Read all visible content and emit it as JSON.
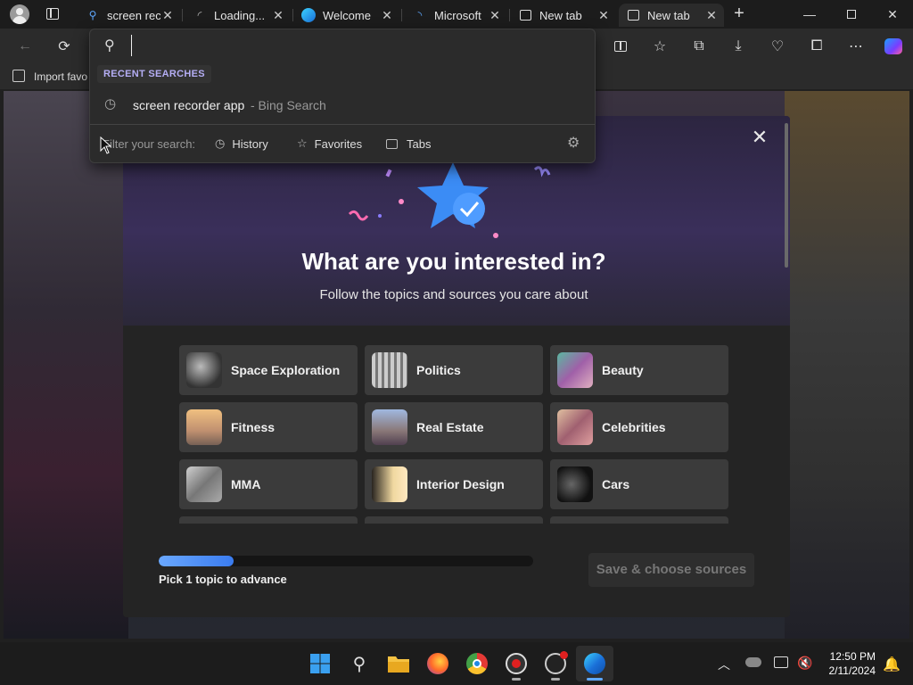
{
  "browser": {
    "tabs": [
      {
        "label": "screen rec",
        "icon": "search-icon",
        "active": false
      },
      {
        "label": "Loading...",
        "icon": "loading-icon",
        "active": false
      },
      {
        "label": "Welcome",
        "icon": "edge-icon",
        "active": false
      },
      {
        "label": "Microsoft",
        "icon": "loading-icon",
        "active": false
      },
      {
        "label": "New tab",
        "icon": "newtab-icon",
        "active": false
      },
      {
        "label": "New tab",
        "icon": "newtab-icon",
        "active": true
      }
    ],
    "favorites_bar": {
      "import_label": "Import favo"
    }
  },
  "search_dropdown": {
    "input_value": "",
    "section_title": "RECENT SEARCHES",
    "recent": [
      {
        "query": "screen recorder app",
        "source": "- Bing Search"
      }
    ],
    "filter_label": "Filter your search:",
    "filters": [
      "History",
      "Favorites",
      "Tabs"
    ]
  },
  "modal": {
    "title": "What are you interested in?",
    "subtitle": "Follow the topics and sources you care about",
    "topics": [
      {
        "name": "Space Exploration",
        "thumb": "#555a66"
      },
      {
        "name": "Politics",
        "thumb": "#8a8a88"
      },
      {
        "name": "Beauty",
        "thumb": "#7a5a80"
      },
      {
        "name": "Fitness",
        "thumb": "#b88a60"
      },
      {
        "name": "Real Estate",
        "thumb": "#6a6a80"
      },
      {
        "name": "Celebrities",
        "thumb": "#a07070"
      },
      {
        "name": "MMA",
        "thumb": "#777777"
      },
      {
        "name": "Interior Design",
        "thumb": "#c0a070"
      },
      {
        "name": "Cars",
        "thumb": "#333333"
      }
    ],
    "progress_label": "Pick 1 topic to advance",
    "progress_fraction": 0.2,
    "save_button": "Save & choose sources"
  },
  "system": {
    "time": "12:50 PM",
    "date": "2/11/2024"
  }
}
